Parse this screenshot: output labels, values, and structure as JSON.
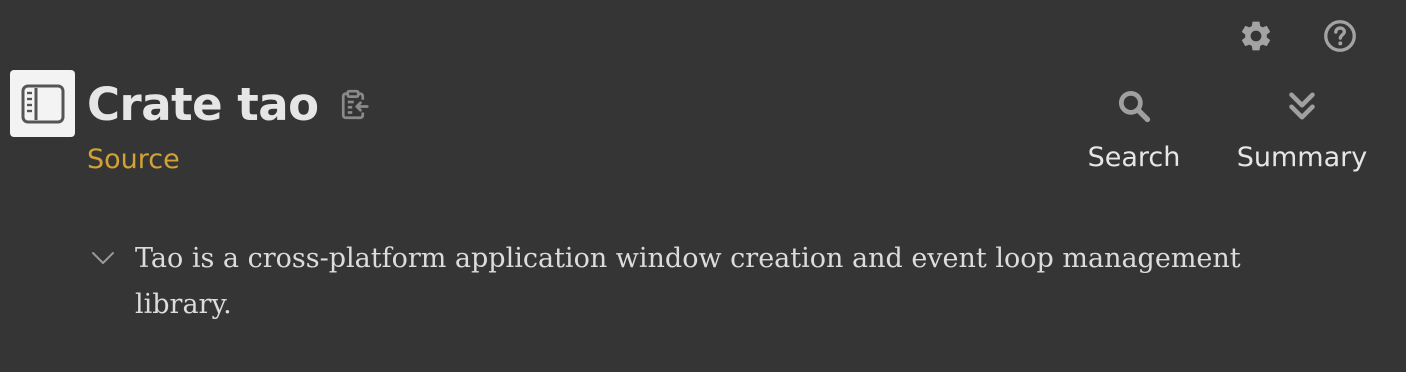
{
  "header": {
    "crate_title": "Crate tao",
    "source_label": "Source"
  },
  "actions": {
    "search_label": "Search",
    "summary_label": "Summary"
  },
  "toolbar": {
    "settings_icon": "gear-icon",
    "help_icon": "question-circle-icon",
    "sidebar_icon": "sidebar-toggle-icon",
    "copy_icon": "clipboard-copy-icon"
  },
  "description": {
    "text": "Tao is a cross-platform application window creation and event loop management library."
  },
  "colors": {
    "background": "#353535",
    "text": "#e6e6e6",
    "source_link": "#d2a137",
    "icon": "#a0a0a0"
  }
}
